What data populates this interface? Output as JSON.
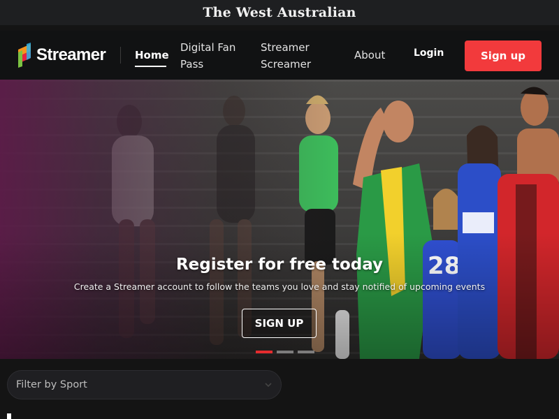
{
  "topbar": {
    "masthead": "The West Australian"
  },
  "nav": {
    "brand": "Streamer",
    "links": [
      {
        "label": "Home",
        "active": true
      },
      {
        "label": "Digital Fan Pass"
      },
      {
        "label": "Streamer Screamer"
      },
      {
        "label": "About"
      }
    ],
    "login_label": "Login",
    "signup_label": "Sign up"
  },
  "hero": {
    "title": "Register for free today",
    "subtitle": "Create a Streamer account to follow the teams you love and stay notified of upcoming events",
    "cta_label": "SIGN UP",
    "slides_total": 3,
    "active_slide": 1
  },
  "filter": {
    "placeholder": "Filter by Sport",
    "icon": "chevron-down-icon"
  },
  "colors": {
    "accent": "#f23a3c",
    "page_bg": "#141414",
    "nav_bg": "#111213"
  }
}
